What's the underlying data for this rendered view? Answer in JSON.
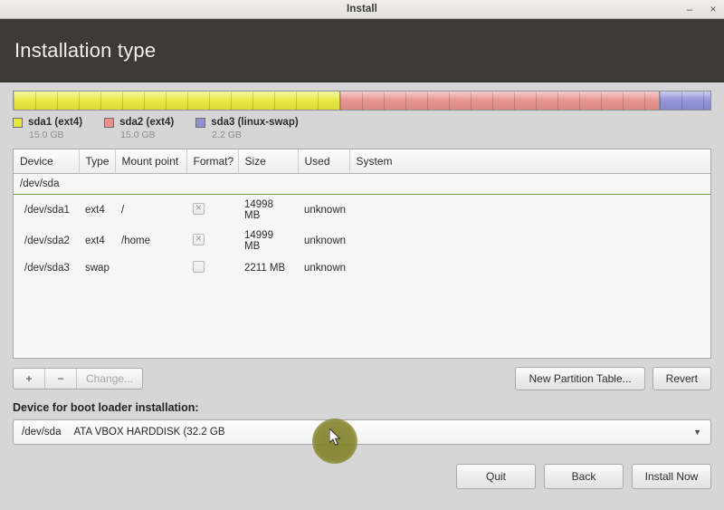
{
  "window": {
    "title": "Install",
    "minimize_label": "–",
    "close_label": "×"
  },
  "header": {
    "title": "Installation type"
  },
  "partition_bar": {
    "segments": [
      {
        "name": "sda1",
        "color": "#e8e83c",
        "percent": 46.7
      },
      {
        "name": "sda2",
        "color": "#e8918f",
        "percent": 45.9
      },
      {
        "name": "sda3",
        "color": "#8f91d8",
        "percent": 7.4
      }
    ]
  },
  "legend": {
    "items": [
      {
        "label": "sda1 (ext4)",
        "size": "15.0 GB",
        "color": "#e8e83c"
      },
      {
        "label": "sda2 (ext4)",
        "size": "15.0 GB",
        "color": "#e8918f"
      },
      {
        "label": "sda3 (linux-swap)",
        "size": "2.2 GB",
        "color": "#8f91d8"
      }
    ]
  },
  "table": {
    "columns": [
      "Device",
      "Type",
      "Mount point",
      "Format?",
      "Size",
      "Used",
      "System"
    ],
    "device_group": "/dev/sda",
    "rows": [
      {
        "device": "/dev/sda1",
        "type": "ext4",
        "mount": "/",
        "format": true,
        "size": "14998 MB",
        "used": "unknown",
        "system": ""
      },
      {
        "device": "/dev/sda2",
        "type": "ext4",
        "mount": "/home",
        "format": true,
        "size": "14999 MB",
        "used": "unknown",
        "system": ""
      },
      {
        "device": "/dev/sda3",
        "type": "swap",
        "mount": "",
        "format": false,
        "size": "2211 MB",
        "used": "unknown",
        "system": ""
      }
    ]
  },
  "toolbar": {
    "add_label": "+",
    "remove_label": "−",
    "change_label": "Change...",
    "new_partition_table_label": "New Partition Table...",
    "revert_label": "Revert"
  },
  "bootloader": {
    "label": "Device for boot loader installation:",
    "selected_device": "/dev/sda",
    "selected_description": "ATA VBOX HARDDISK (32.2 GB",
    "arrow": "▼"
  },
  "footer": {
    "quit_label": "Quit",
    "back_label": "Back",
    "install_label": "Install Now"
  },
  "colors": {
    "header_bg": "#3c3b37",
    "selection_green": "#82ab5f",
    "cursor_highlight": "#808126"
  }
}
